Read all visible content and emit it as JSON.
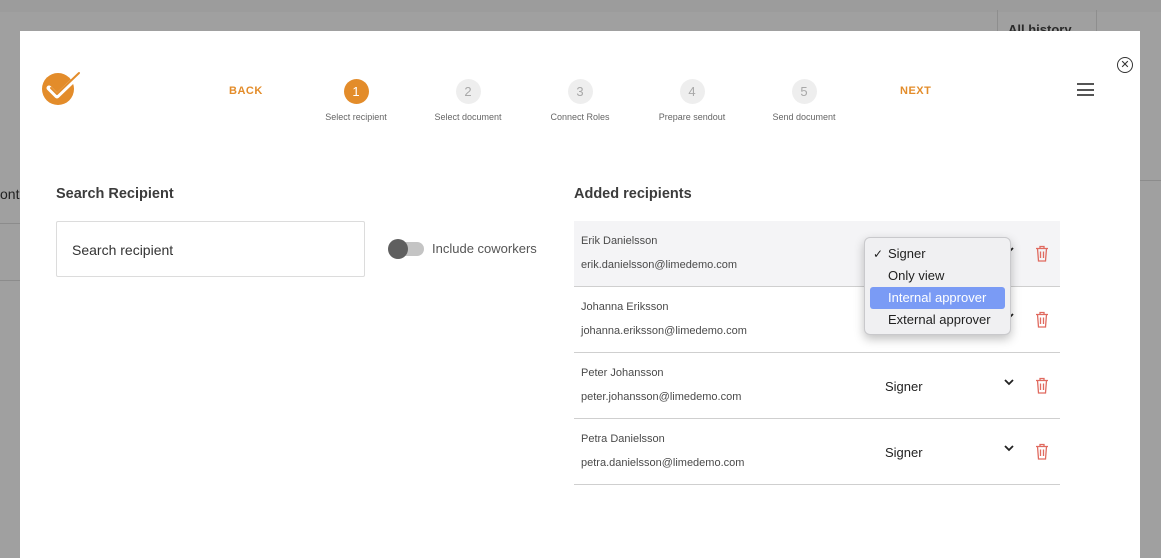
{
  "background": {
    "history_label": "All history",
    "cont_label": "ont"
  },
  "header": {
    "back_label": "BACK",
    "next_label": "NEXT",
    "steps": [
      {
        "number": "1",
        "label": "Select recipient",
        "active": true
      },
      {
        "number": "2",
        "label": "Select document",
        "active": false
      },
      {
        "number": "3",
        "label": "Connect Roles",
        "active": false
      },
      {
        "number": "4",
        "label": "Prepare sendout",
        "active": false
      },
      {
        "number": "5",
        "label": "Send document",
        "active": false
      }
    ]
  },
  "search": {
    "title": "Search Recipient",
    "placeholder": "Search recipient",
    "toggle_label": "Include coworkers",
    "toggle_on": false
  },
  "recipients": {
    "title": "Added recipients",
    "items": [
      {
        "name": "Erik Danielsson",
        "email": "erik.danielsson@limedemo.com",
        "role": "Signer"
      },
      {
        "name": "Johanna Eriksson",
        "email": "johanna.eriksson@limedemo.com",
        "role": "Signer"
      },
      {
        "name": "Peter Johansson",
        "email": "peter.johansson@limedemo.com",
        "role": "Signer"
      },
      {
        "name": "Petra Danielsson",
        "email": "petra.danielsson@limedemo.com",
        "role": "Signer"
      }
    ]
  },
  "role_dropdown": {
    "check": "✓",
    "options": [
      "Signer",
      "Only view",
      "Internal approver",
      "External approver"
    ],
    "selected": "Signer",
    "highlighted": "Internal approver"
  },
  "colors": {
    "accent": "#e38c2a",
    "highlight": "#7a9bf5",
    "delete": "#e06a5f"
  },
  "icons": {
    "close": "close-icon",
    "menu": "hamburger-menu-icon",
    "delete": "trash-icon",
    "chevron": "chevron-down-icon"
  }
}
